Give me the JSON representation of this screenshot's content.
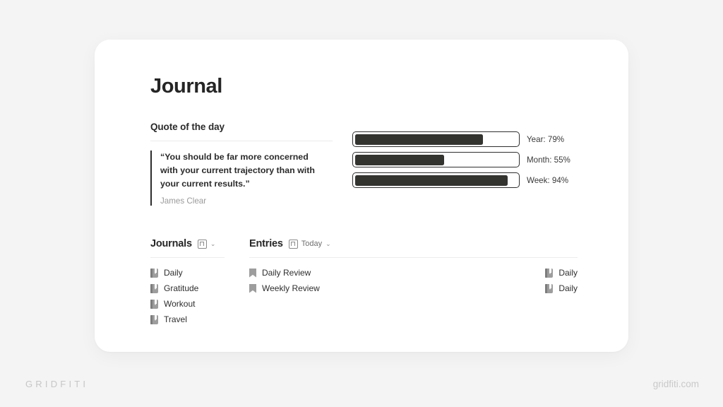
{
  "page": {
    "title": "Journal"
  },
  "quote": {
    "section_label": "Quote of the day",
    "text": "“You should be far more concerned with your current trajectory than with your current results.”",
    "author": "James Clear"
  },
  "progress": {
    "items": [
      {
        "label": "Year: 79%",
        "name": "Year",
        "percent": 79
      },
      {
        "label": "Month: 55%",
        "name": "Month",
        "percent": 55
      },
      {
        "label": "Week: 94%",
        "name": "Week",
        "percent": 94
      }
    ]
  },
  "journals": {
    "title": "Journals",
    "view_icon": "page-view-icon",
    "view_label": "",
    "chevron": "⌄",
    "items": [
      {
        "label": "Daily",
        "icon": "book-icon"
      },
      {
        "label": "Gratitude",
        "icon": "book-icon"
      },
      {
        "label": "Workout",
        "icon": "book-icon"
      },
      {
        "label": "Travel",
        "icon": "book-icon"
      }
    ]
  },
  "entries": {
    "title": "Entries",
    "view_icon": "page-view-icon",
    "view_label": "Today",
    "chevron": "⌄",
    "items": [
      {
        "label": "Daily Review",
        "icon": "bookmark-icon",
        "relation": "Daily",
        "relation_icon": "book-icon"
      },
      {
        "label": "Weekly Review",
        "icon": "bookmark-icon",
        "relation": "Daily",
        "relation_icon": "book-icon"
      }
    ]
  },
  "branding": {
    "left": "GRIDFITI",
    "right": "gridfiti.com"
  },
  "colors": {
    "background": "#f4f4f4",
    "card": "#ffffff",
    "ink": "#2b2b2b",
    "progress_fill": "#333330",
    "muted": "#9a9a9a"
  }
}
